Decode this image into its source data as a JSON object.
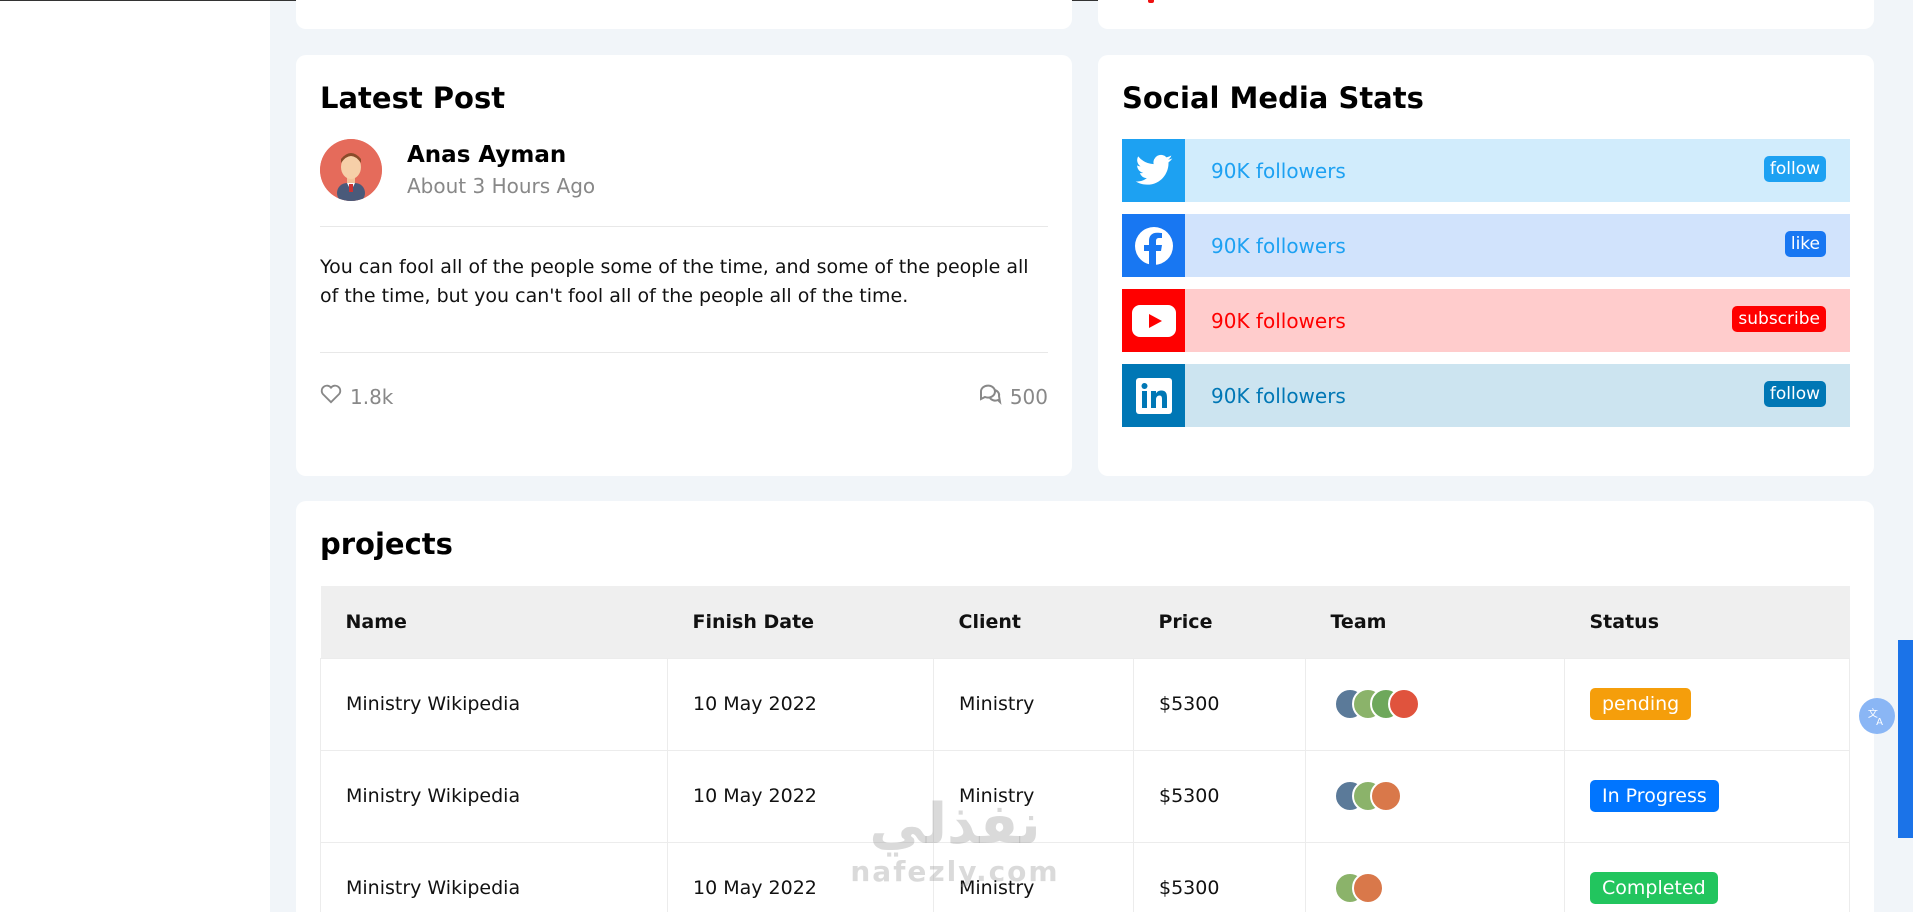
{
  "latest_post": {
    "title": "Latest Post",
    "author_name": "Anas Ayman",
    "time": "About 3 Hours Ago",
    "body": "You can fool all of the people some of the time, and some of the people all of the time, but you can't fool all of the people all of the time.",
    "likes": "1.8k",
    "comments": "500"
  },
  "social": {
    "title": "Social Media Stats",
    "rows": [
      {
        "network": "twitter",
        "followers": "90K followers",
        "button": "follow",
        "icon": "twitter-icon",
        "color": "#1da1f2",
        "bg": "#d1ecfc",
        "text_color": "#1da1f2"
      },
      {
        "network": "facebook",
        "followers": "90K followers",
        "button": "like",
        "icon": "facebook-icon",
        "color": "#1877f2",
        "bg": "#d1e3fc",
        "text_color": "#1da1f2"
      },
      {
        "network": "youtube",
        "followers": "90K followers",
        "button": "subscribe",
        "icon": "youtube-icon",
        "color": "#ff0000",
        "bg": "#ffcccc",
        "text_color": "#ff0000"
      },
      {
        "network": "linkedin",
        "followers": "90K followers",
        "button": "follow",
        "icon": "linkedin-icon",
        "color": "#0077b5",
        "bg": "#cce4f0",
        "text_color": "#0077b5"
      }
    ]
  },
  "projects": {
    "title": "projects",
    "headers": [
      "Name",
      "Finish Date",
      "Client",
      "Price",
      "Team",
      "Status"
    ],
    "rows": [
      {
        "name": "Ministry Wikipedia",
        "date": "10 May 2022",
        "client": "Ministry",
        "price": "$5300",
        "team_size": 4,
        "status": "pending",
        "status_color": "#f59e0b"
      },
      {
        "name": "Ministry Wikipedia",
        "date": "10 May 2022",
        "client": "Ministry",
        "price": "$5300",
        "team_size": 3,
        "status": "In Progress",
        "status_color": "#0075ff"
      },
      {
        "name": "Ministry Wikipedia",
        "date": "10 May 2022",
        "client": "Ministry",
        "price": "$5300",
        "team_size": 2,
        "status": "Completed",
        "status_color": "#22c55e"
      }
    ]
  },
  "watermark": {
    "arabic": "نفذلي",
    "latin": "nafezly.com"
  },
  "colors": {
    "accent": "#0075ff",
    "pending": "#f59e0b",
    "completed": "#22c55e"
  }
}
